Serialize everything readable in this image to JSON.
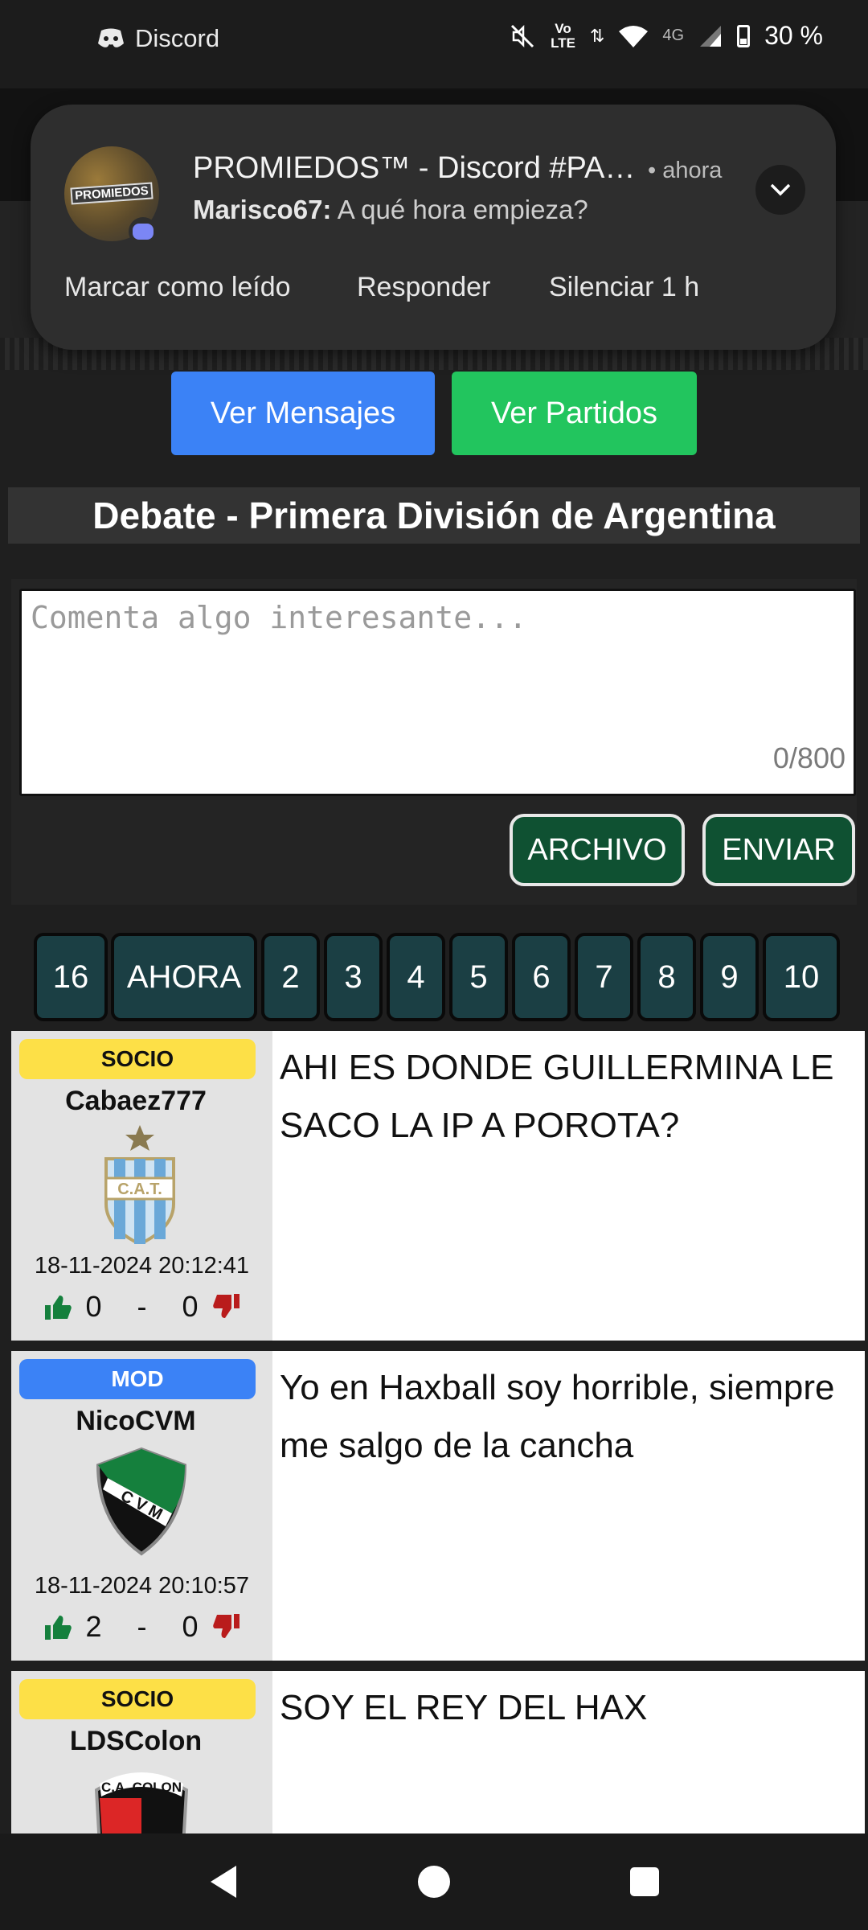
{
  "status_bar": {
    "app_name": "Discord",
    "battery": "30 %",
    "network": "4G",
    "volte": "Vo\nLTE"
  },
  "notification": {
    "title": "PROMIEDOS™ - Discord #PAR...",
    "time": "• ahora",
    "sender": "Marisco67:",
    "message": "A qué hora empieza?",
    "avatar_text": "PROMIEDOS",
    "actions": [
      "Marcar como leído",
      "Responder",
      "Silenciar 1 h"
    ]
  },
  "nav": {
    "messages": "Ver Mensajes",
    "matches": "Ver Partidos"
  },
  "debate_title": "Debate - Primera División de Argentina",
  "comment": {
    "placeholder": "Comenta algo interesante...",
    "counter": "0/800",
    "file_button": "ARCHIVO",
    "send_button": "ENVIAR"
  },
  "pagination": [
    "16",
    "AHORA",
    "2",
    "3",
    "4",
    "5",
    "6",
    "7",
    "8",
    "9",
    "10"
  ],
  "posts": [
    {
      "badge": "SOCIO",
      "user": "Cabaez777",
      "crest_text": "C.A.T.",
      "date": "18-11-2024 20:12:41",
      "likes": "0",
      "separator": "-",
      "dislikes": "0",
      "text": "AHI ES DONDE GUILLERMINA LE SACO LA IP A POROTA?"
    },
    {
      "badge": "MOD",
      "user": "NicoCVM",
      "crest_text": "C V M",
      "date": "18-11-2024 20:10:57",
      "likes": "2",
      "separator": "-",
      "dislikes": "0",
      "text": "Yo en Haxball soy horrible, siempre me salgo de la cancha"
    },
    {
      "badge": "SOCIO",
      "user": "LDSColon",
      "crest_text": "C.A. COLON",
      "text": "SOY EL REY DEL HAX"
    }
  ],
  "colors": {
    "blue": "#3b82f6",
    "green": "#22c55e",
    "socio": "#fde047",
    "send_green": "#0f5132",
    "page_teal": "#1b3f44"
  }
}
